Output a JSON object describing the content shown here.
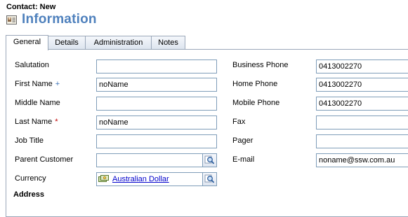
{
  "header": {
    "entity_line": "Contact: New",
    "title": "Information"
  },
  "tabs": [
    {
      "label": "General",
      "active": true
    },
    {
      "label": "Details",
      "active": false
    },
    {
      "label": "Administration",
      "active": false
    },
    {
      "label": "Notes",
      "active": false
    }
  ],
  "left_fields": {
    "salutation": {
      "label": "Salutation",
      "value": ""
    },
    "first_name": {
      "label": "First Name",
      "marker": "+",
      "value": "noName"
    },
    "middle_name": {
      "label": "Middle Name",
      "value": ""
    },
    "last_name": {
      "label": "Last Name",
      "marker": "*",
      "value": "noName"
    },
    "job_title": {
      "label": "Job Title",
      "value": ""
    },
    "parent_customer": {
      "label": "Parent Customer",
      "value": ""
    },
    "currency": {
      "label": "Currency",
      "value": "Australian Dollar"
    }
  },
  "right_fields": {
    "business_phone": {
      "label": "Business Phone",
      "value": "0413002270"
    },
    "home_phone": {
      "label": "Home Phone",
      "value": "0413002270"
    },
    "mobile_phone": {
      "label": "Mobile Phone",
      "value": "0413002270"
    },
    "fax": {
      "label": "Fax",
      "value": ""
    },
    "pager": {
      "label": "Pager",
      "value": ""
    },
    "email": {
      "label": "E-mail",
      "value": "noname@ssw.com.au"
    }
  },
  "section": {
    "address_title": "Address"
  },
  "icons": {
    "header": "contact-card-icon",
    "lookup": "magnifier-icon",
    "currency": "currency-icon"
  },
  "colors": {
    "title": "#4f81bd",
    "required_marker": "#c00000",
    "recommended_marker": "#3a70b5",
    "link": "#0000cc"
  }
}
